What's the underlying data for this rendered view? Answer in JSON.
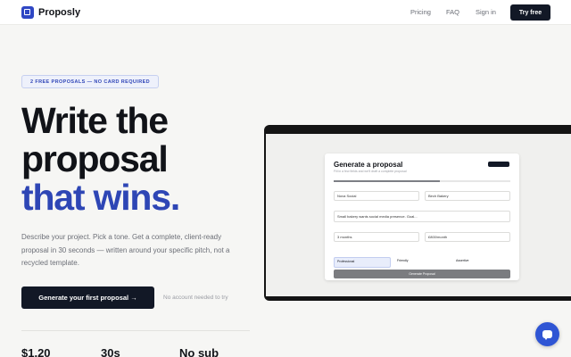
{
  "nav": {
    "brand": "Proposly",
    "links": [
      "Pricing",
      "FAQ",
      "Sign in"
    ],
    "cta": "Try free"
  },
  "hero": {
    "badge": "2 FREE PROPOSALS — NO CARD REQUIRED",
    "headline_line1": "Write the",
    "headline_line2": "proposal",
    "headline_line3": "that wins.",
    "description": "Describe your project. Pick a tone. Get a complete, client-ready proposal in 30 seconds — written around your specific pitch, not a recycled template.",
    "cta": "Generate your first proposal →",
    "cta_note": "No account needed to try"
  },
  "stats": [
    "$1.20",
    "30s",
    "No sub"
  ],
  "mock": {
    "title": "Generate a proposal",
    "subtitle": "Fill in a few fields and we'll draft a complete proposal",
    "progress": 0.6,
    "project_value": "Nova Social",
    "client_value": "Birch Bakery",
    "description_value": "Small bakery wants social media presence. Goal...",
    "timeline_value": "3 months",
    "budget_value": "£800/month",
    "tones": [
      "Professional",
      "Friendly",
      "Assertive"
    ],
    "generate_label": "Generate Proposal"
  },
  "colors": {
    "accent": "#2e46b5",
    "dark": "#121826",
    "chat": "#2f55d4"
  },
  "icons": {
    "logo": "proposly-logo-icon",
    "chat": "chat-bubble-icon"
  }
}
